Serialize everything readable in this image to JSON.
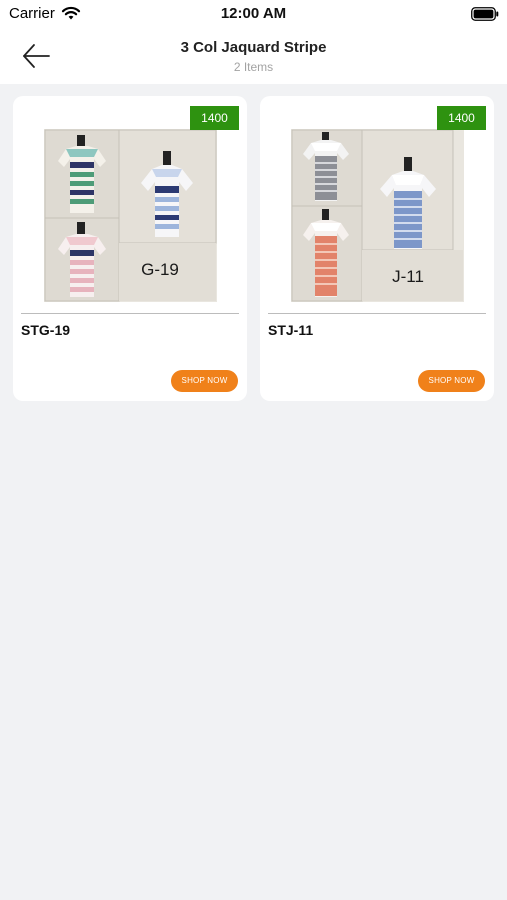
{
  "status": {
    "carrier": "Carrier",
    "time": "12:00 AM"
  },
  "header": {
    "title": "3 Col Jaquard Stripe",
    "subtitle": "2 Items"
  },
  "products": [
    {
      "name": "STG-19",
      "price": "1400",
      "image_label": "G-19",
      "cta": "SHOP NOW",
      "shirt_colors": [
        "#5f9f8e",
        "#9bb8d9",
        "#e8b5bf"
      ]
    },
    {
      "name": "STJ-11",
      "price": "1400",
      "image_label": "J-11",
      "cta": "SHOP NOW",
      "shirt_colors": [
        "#8e8f95",
        "#7f98c8",
        "#e08466"
      ]
    }
  ],
  "colors": {
    "price_badge": "#2e9210",
    "shop_button": "#f0811a",
    "background": "#f1f2f4"
  },
  "icons": {
    "back": "arrow-left-icon",
    "wifi": "wifi-icon",
    "battery": "battery-icon"
  }
}
